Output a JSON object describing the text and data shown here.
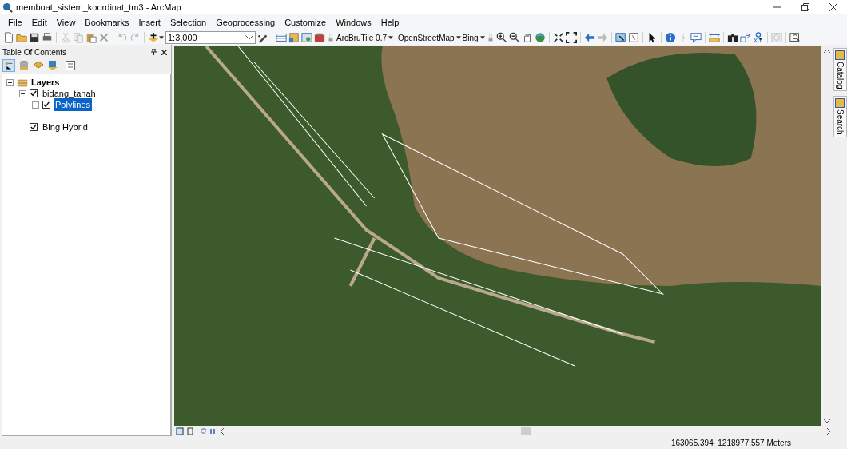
{
  "window": {
    "title": "membuat_sistem_koordinat_tm3 - ArcMap"
  },
  "menu": [
    "File",
    "Edit",
    "View",
    "Bookmarks",
    "Insert",
    "Selection",
    "Geoprocessing",
    "Customize",
    "Windows",
    "Help"
  ],
  "toolbar": {
    "scale": "1:3,000",
    "dropdowns": [
      "ArcBruTile 0.7",
      "OpenStreetMap",
      "Bing"
    ]
  },
  "table_of_contents": {
    "title": "Table Of Contents",
    "tree": [
      {
        "kind": "frame",
        "label": "Layers",
        "expanded": true,
        "children": [
          {
            "kind": "layer",
            "label": "bidang_tanah",
            "checked": true,
            "expanded": true,
            "selected": false,
            "children": [
              {
                "kind": "layer",
                "label": "Polylines",
                "checked": true,
                "expanded": true,
                "selected": true
              }
            ]
          },
          {
            "kind": "layer",
            "label": "Bing Hybrid",
            "checked": true,
            "selected": false
          }
        ]
      }
    ]
  },
  "side_tabs": [
    "Catalog",
    "Search"
  ],
  "status_bar": {
    "coordinates": "163065.394  1218977.557 Meters"
  }
}
